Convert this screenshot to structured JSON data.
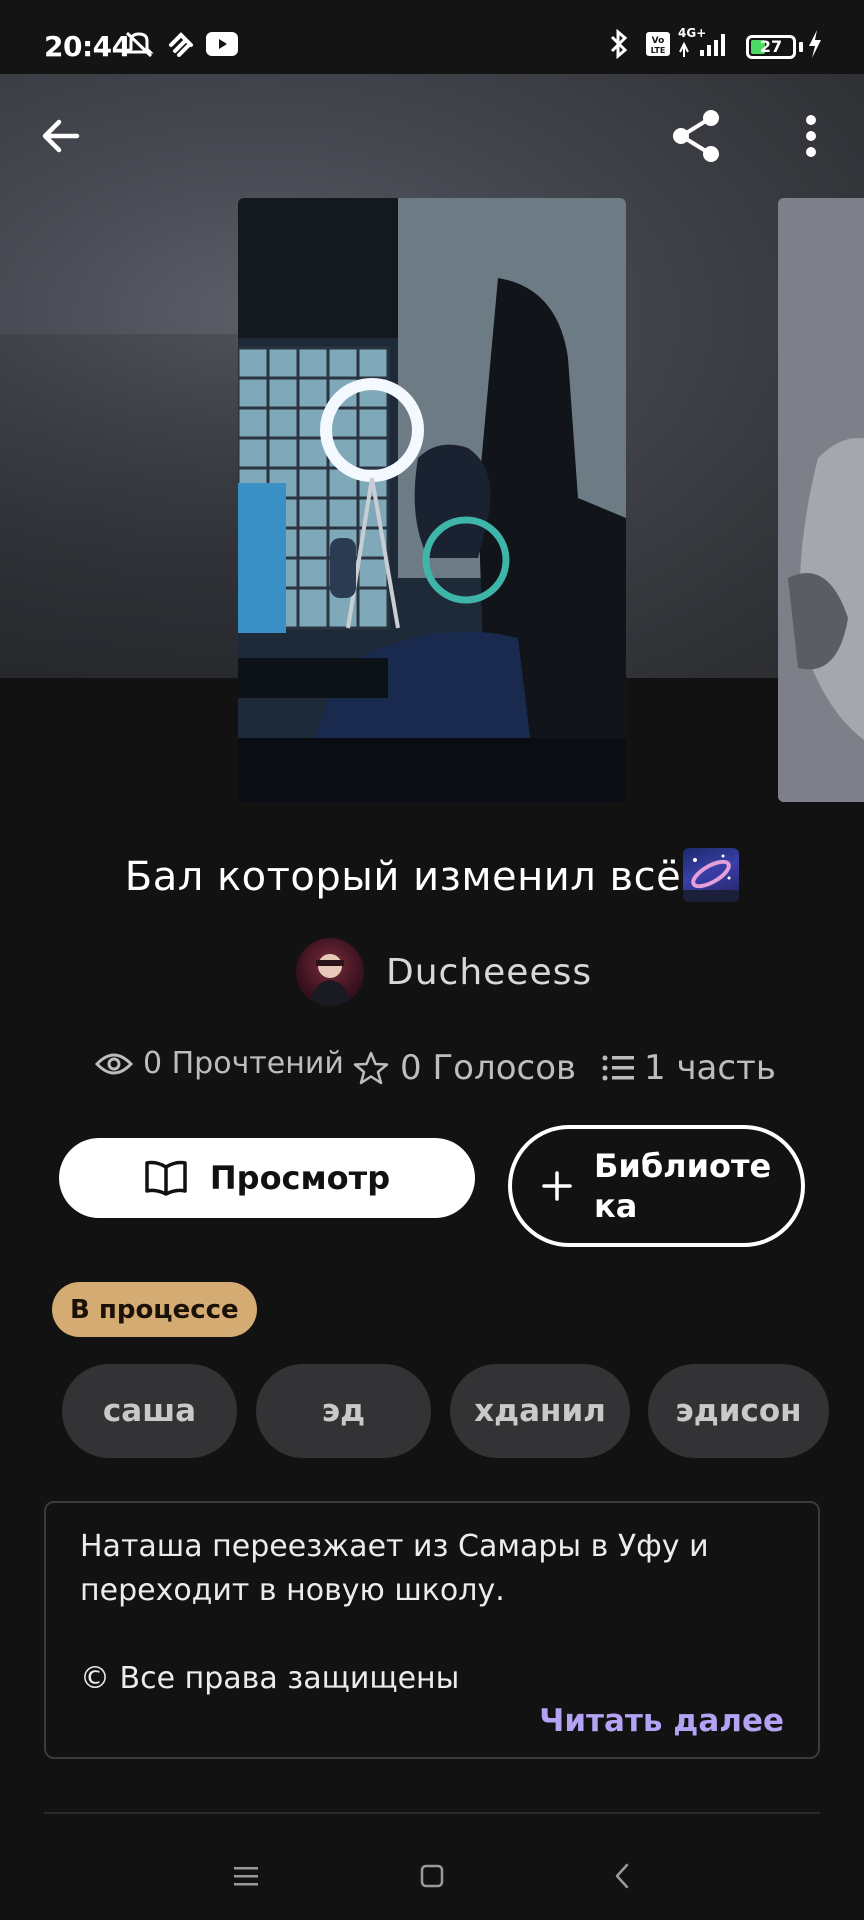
{
  "status_bar": {
    "time": "20:44",
    "battery": "27",
    "network": "4G+",
    "icons": [
      "mute-icon",
      "heart-icon",
      "youtube-icon",
      "bluetooth-icon",
      "volte-icon",
      "signal-icon",
      "battery-icon",
      "charging-icon"
    ]
  },
  "toolbar": {
    "back_icon": "arrow-left-icon",
    "share_icon": "share-icon",
    "more_icon": "more-vertical-icon"
  },
  "story": {
    "title": "Бал который изменил всё",
    "author": "Ducheeess",
    "stats": {
      "reads": "0 Прочтений",
      "votes": "0 Голосов",
      "parts": "1 часть"
    },
    "view_button": "Просмотр",
    "library_button": "Библиотека",
    "status": "В процессе",
    "tags": [
      "саша",
      "эд",
      "хданил",
      "эдисон"
    ],
    "description": {
      "line1": "Наташа переезжает из Самары в Уфу и переходит в новую школу.",
      "copyright": "© Все права защищены"
    },
    "read_more": "Читать далее"
  },
  "colors": {
    "background": "#121212",
    "status_badge": "#d4ab72",
    "tag_bg": "#333335",
    "accent_link": "#b4a2f5"
  },
  "nav": {
    "menu_icon": "menu-icon",
    "home_icon": "square-home-icon",
    "back_icon": "chevron-left-icon"
  }
}
